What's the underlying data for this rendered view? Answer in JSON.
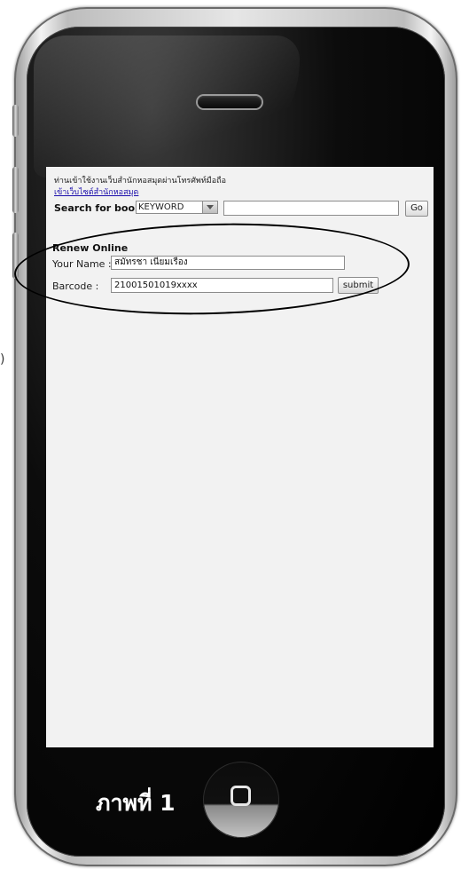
{
  "screen": {
    "intro_text": "ท่านเข้าใช้งานเว็บสำนักหอสมุดผ่านโทรศัพท์มือถือ",
    "site_link": "เข้าเว็บไซต์สำนักหอสมุด",
    "search_label": "Search for books",
    "search_type_selected": "KEYWORD",
    "search_input_value": "",
    "go_label": "Go",
    "renew_title": "Renew Online",
    "name_label": "Your Name :",
    "name_value": "สมัทรชา เนียมเรือง",
    "barcode_label": "Barcode :",
    "barcode_value": "21001501019xxxx",
    "submit_label": "submit"
  },
  "caption": "ภาพที่ 1",
  "side_text": ")",
  "icons": {
    "speaker": "speaker-icon",
    "home": "home-button-icon",
    "select_arrow": "chevron-down-icon"
  },
  "colors": {
    "link": "#1a0dab",
    "screen_bg": "#f2f2f2",
    "bezel": "#000000"
  }
}
